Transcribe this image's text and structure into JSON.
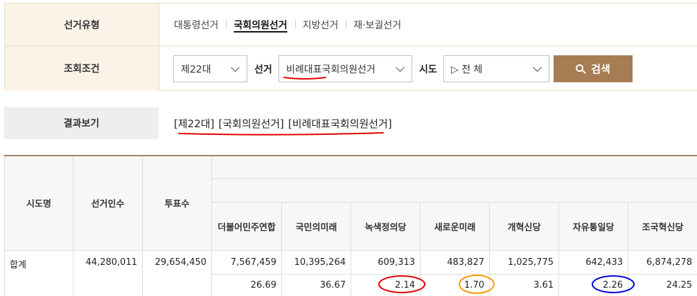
{
  "condition": {
    "type_label": "선거유형",
    "tabs": [
      {
        "label": "대통령선거",
        "active": false
      },
      {
        "label": "국회의원선거",
        "active": true
      },
      {
        "label": "지방선거",
        "active": false
      },
      {
        "label": "재·보궐선거",
        "active": false
      }
    ],
    "query_label": "조회조건",
    "session": {
      "value": "제22대"
    },
    "election_label": "선거",
    "election": {
      "value": "비례대표국회의원선거"
    },
    "region_label": "시도",
    "region": {
      "value": "▷ 전 체"
    },
    "search_button": "검색"
  },
  "result": {
    "label": "결과보기",
    "items": [
      "[제22대]",
      "[국회의원선거]",
      "[비례대표국회의원선거]"
    ]
  },
  "table": {
    "headers": {
      "region": "시도명",
      "electorate": "선거인수",
      "voters": "투표수"
    },
    "parties": [
      "더불어민주연합",
      "국민의미래",
      "녹색정의당",
      "새로운미래",
      "개혁신당",
      "자유통일당",
      "조국혁신당"
    ],
    "total_label": "합계",
    "total": {
      "electorate": "44,280,011",
      "voters": "29,654,450",
      "votes": [
        "7,567,459",
        "10,395,264",
        "609,313",
        "483,827",
        "1,025,775",
        "642,433",
        "6,874,278"
      ],
      "percents": [
        "26.69",
        "36.67",
        "2.14",
        "1.70",
        "3.61",
        "2.26",
        "24.25"
      ]
    }
  },
  "annotation_colors": {
    "red": "#e00000",
    "orange": "#ff9900",
    "blue": "#0000dd"
  }
}
